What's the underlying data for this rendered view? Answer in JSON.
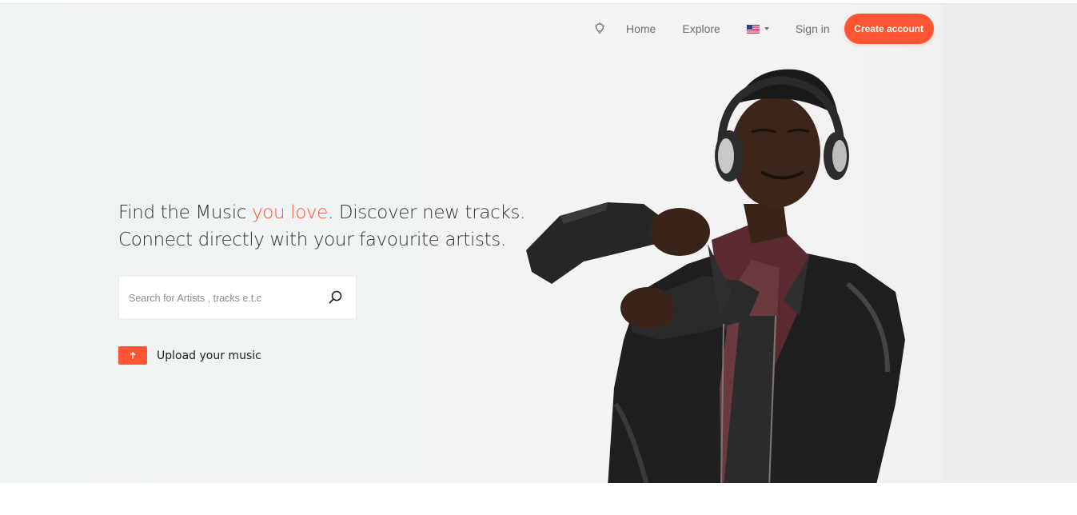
{
  "nav": {
    "home": "Home",
    "explore": "Explore",
    "signin": "Sign in",
    "create_account": "Create account"
  },
  "hero": {
    "headline_part1": "Find the Music ",
    "headline_accent": "you love",
    "headline_part2": ". Discover new tracks.",
    "headline_line2": "Connect directly with your favourite artists.",
    "search_placeholder": "Search for Artists , tracks e.t.c",
    "upload_label": "Upload your music"
  },
  "colors": {
    "accent": "#ff5533",
    "text_dark": "#2f3133",
    "nav_text": "#6e6e6e"
  },
  "icons": {
    "theme_toggle": "lightbulb-icon",
    "language_flag": "us-flag-icon",
    "search": "search-icon",
    "upload": "upload-arrow-icon"
  }
}
